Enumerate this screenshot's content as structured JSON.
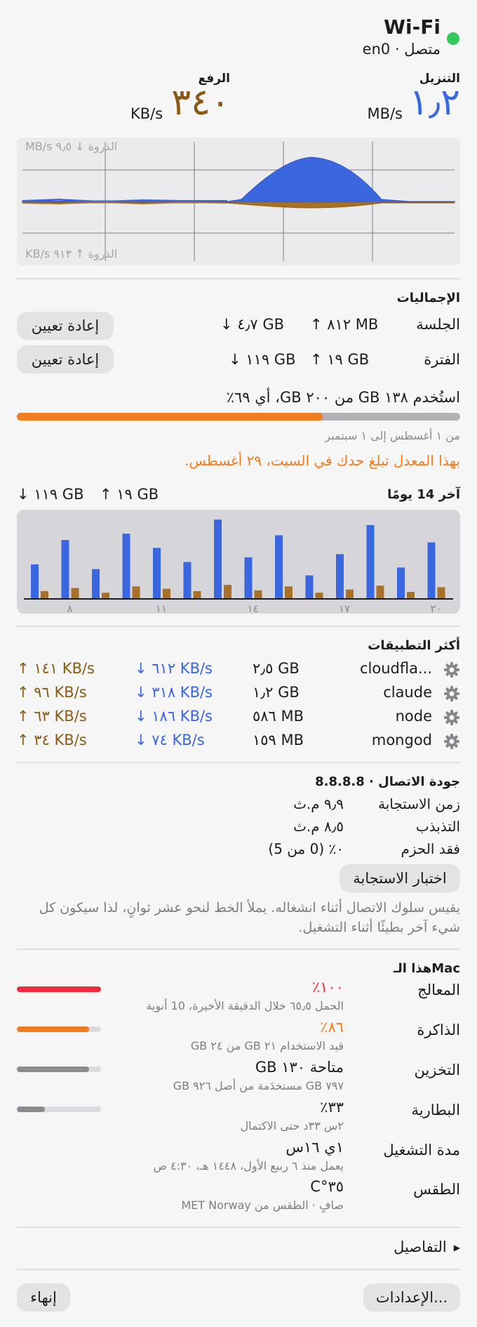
{
  "header": {
    "title": "Wi-Fi",
    "status": "متصل",
    "interface": "en0",
    "status_color": "#34c759"
  },
  "speeds": {
    "download_label": "التنزيل",
    "download_value": "١٫٢",
    "download_unit": "MB/s",
    "upload_label": "الرفع",
    "upload_value": "٣٤٠",
    "upload_unit": "KB/s",
    "download_color": "#3a66e0",
    "upload_color": "#8a5a14"
  },
  "graph": {
    "peak_down": "الذروة ↓ ٩٫٥ MB/s",
    "peak_up": "الذروة ↑ ٩١٣ KB/s"
  },
  "totals": {
    "title": "الإجماليات",
    "session_label": "الجلسة",
    "session_down": "↓ ٤٫٧ GB",
    "session_up": "↑ ٨١٢ MB",
    "period_label": "الفترة",
    "period_down": "↓ ١١٩ GB",
    "period_up": "↑ ١٩ GB",
    "reset_label": "إعادة تعيين"
  },
  "usage": {
    "text": "استُخدم ١٣٨ GB من ٢٠٠ GB، أي ٦٩٪",
    "fraction": 0.69,
    "period": "من ١ أغسطس إلى ١ سبتمبر",
    "warning": "بهذا المعدل تبلغ حدك في السبت، ٢٩ أغسطس.",
    "warning_color": "#f07d1f"
  },
  "last14": {
    "title": "آخر 14 يومًا",
    "down": "↓ ١١٩ GB",
    "up": "↑ ١٩ GB",
    "ticks": [
      "٨",
      "١١",
      "١٤",
      "١٧",
      "٢٠"
    ],
    "down_values": [
      0.43,
      0.74,
      0.37,
      0.82,
      0.64,
      0.46,
      1.0,
      0.52,
      0.8,
      0.29,
      0.56,
      0.93,
      0.39,
      0.71
    ],
    "up_values": [
      0.09,
      0.13,
      0.07,
      0.15,
      0.12,
      0.09,
      0.17,
      0.1,
      0.15,
      0.07,
      0.11,
      0.16,
      0.08,
      0.14
    ]
  },
  "apps": {
    "title": "أكثر التطبيقات",
    "rows": [
      {
        "name": "cloudfla...",
        "total": "٢٫٥ GB",
        "down": "↓ ٦١٢ KB/s",
        "up": "↑ ١٤١ KB/s"
      },
      {
        "name": "claude",
        "total": "١٫٢ GB",
        "down": "↓ ٣١٨ KB/s",
        "up": "↑ ٩٦ KB/s"
      },
      {
        "name": "node",
        "total": "٥٨٦ MB",
        "down": "↓ ١٨٦ KB/s",
        "up": "↑ ٦٣ KB/s"
      },
      {
        "name": "mongod",
        "total": "١٥٩ MB",
        "down": "↓ ٧٤ KB/s",
        "up": "↑ ٣٤ KB/s"
      }
    ]
  },
  "quality": {
    "title": "جودة الاتصال · 8.8.8.8",
    "latency_label": "زمن الاستجابة",
    "latency_value": "٩٫٩ م.ث",
    "jitter_label": "التذبذب",
    "jitter_value": "٨٫٥ م.ث",
    "loss_label": "فقد الحزم",
    "loss_value": "٠٪  (0 من 5)",
    "test_button": "اختبار الاستجابة",
    "description": "يقيس سلوك الاتصال أثناء انشغاله. يملأ الخط لنحو عشر ثوانٍ، لذا سيكون كل شيء آخر بطيئًا أثناء التشغيل."
  },
  "mac": {
    "title": "هذا الـMac",
    "cpu_label": "المعالج",
    "cpu_value": "١٠٠٪",
    "cpu_sub": "الحمل ٦٥٫٥ خلال الدقيقة الأخيرة، 10 أنوية",
    "cpu_fraction": 1.0,
    "cpu_color": "#ee2b3c",
    "mem_label": "الذاكرة",
    "mem_value": "٨٦٪",
    "mem_sub": "قيد الاستخدام ٢١ GB من ٢٤ GB",
    "mem_fraction": 0.86,
    "mem_color": "#f07d1f",
    "disk_label": "التخزين",
    "disk_value": "متاحة ١٣٠ GB",
    "disk_sub": "٧٩٧ GB مستخدَمة من أصل ٩٢٦ GB",
    "disk_fraction": 0.86,
    "disk_color": "#8a8a90",
    "battery_label": "البطارية",
    "battery_value": "٣٣٪",
    "battery_sub": "٢س ٣٣د حتى الاكتمال",
    "battery_fraction": 0.33,
    "battery_color": "#8a8a90",
    "uptime_label": "مدة التشغيل",
    "uptime_value": "١ي ١٦س",
    "uptime_sub": "يعمل منذ ٦ ربيع الأول، ١٤٤٨ هـ، ٤:٣٠ ص",
    "weather_label": "الطقس",
    "weather_value": "٣٥°C",
    "weather_sub": "صافٍ · الطقس من MET Norway"
  },
  "footer": {
    "details": "التفاصيل",
    "settings": "الإعدادات...",
    "quit": "إنهاء"
  }
}
